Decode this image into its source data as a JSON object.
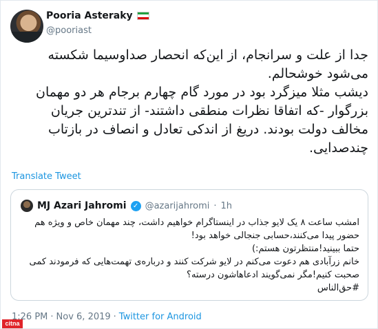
{
  "author": {
    "display_name": "Pooria Asteraky",
    "handle": "@pooriast",
    "flag_colors": [
      "#239f40",
      "#ffffff",
      "#da0000"
    ]
  },
  "tweet": {
    "text": "جدا از علت و سرانجام، از این‌که انحصار صداوسیما شکسته\nمی‌شود خوشحالم.\nدیشب مثلا میزگرد بود در مورد گام چهارم برجام هر دو مهمان\nبزرگوار -که اتفاقا نظرات منطقی داشتند- از تندترین جریان\nمخالف دولت بودند. دریغ از اندکی تعادل و انصاف در بازتاب\nچندصدایی.",
    "translate_label": "Translate Tweet"
  },
  "quoted": {
    "display_name": "MJ Azari Jahromi",
    "verified_mark": "✓",
    "handle": "@azarijahromi",
    "separator": "·",
    "time": "1h",
    "text": "امشب ساعت ۸ یک لایو جذاب در اینستاگرام خواهیم داشت، چند مهمان خاص و ویژه هم\nحضور پیدا می‌کنند،حسابی جنجالی خواهد بود!\nحتما ببینید!منتظرتون هستم:)\nخانم زرآبادی هم دعوت می‌کنم در لایو شرکت کنند و درباره‌ی تهمت‌هایی که فرمودند کمی\nصحبت کنیم!مگر نمی‌گویند ادعاهاشون درسته؟\n#حق‌الناس"
  },
  "meta": {
    "time": "1:26 PM",
    "sep1": "·",
    "date": "Nov 6, 2019",
    "sep2": "·",
    "source": "Twitter for Android"
  },
  "watermark": "citna"
}
